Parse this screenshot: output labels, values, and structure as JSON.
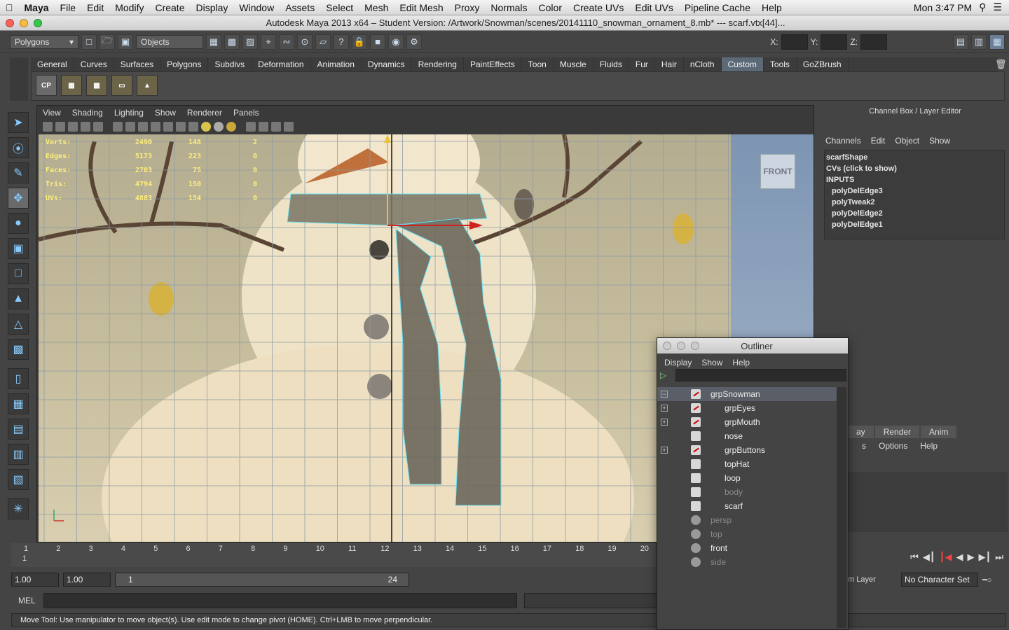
{
  "menubar": {
    "app": "Maya",
    "items": [
      "File",
      "Edit",
      "Modify",
      "Create",
      "Display",
      "Window",
      "Assets",
      "Select",
      "Mesh",
      "Edit Mesh",
      "Proxy",
      "Normals",
      "Color",
      "Create UVs",
      "Edit UVs",
      "Pipeline Cache",
      "Help"
    ],
    "clock": "Mon 3:47 PM"
  },
  "window": {
    "title": "Autodesk Maya 2013 x64 – Student Version: /Artwork/Snowman/scenes/20141110_snowman_ornament_8.mb*   ---   scarf.vtx[44]..."
  },
  "statusline": {
    "mode": "Polygons",
    "select_mode": "Objects",
    "x_label": "X:",
    "y_label": "Y:",
    "z_label": "Z:"
  },
  "shelf": {
    "tabs": [
      "General",
      "Curves",
      "Surfaces",
      "Polygons",
      "Subdivs",
      "Deformation",
      "Animation",
      "Dynamics",
      "Rendering",
      "PaintEffects",
      "Toon",
      "Muscle",
      "Fluids",
      "Fur",
      "Hair",
      "nCloth",
      "Custom",
      "Tools",
      "GoZBrush"
    ],
    "active_tab": "Custom",
    "cp_label": "CP"
  },
  "viewport": {
    "menu": [
      "View",
      "Shading",
      "Lighting",
      "Show",
      "Renderer",
      "Panels"
    ],
    "view_cube": "FRONT",
    "hud": [
      [
        "Verts:",
        "2490",
        "148",
        "2"
      ],
      [
        "Edges:",
        "5173",
        "223",
        "0"
      ],
      [
        "Faces:",
        "2703",
        "75",
        "0"
      ],
      [
        "Tris:",
        "4794",
        "150",
        "0"
      ],
      [
        "UVs:",
        "4883",
        "154",
        "0"
      ]
    ]
  },
  "timeline": {
    "ticks": [
      "1",
      "2",
      "3",
      "4",
      "5",
      "6",
      "7",
      "8",
      "9",
      "10",
      "11",
      "12",
      "13",
      "14",
      "15",
      "16",
      "17",
      "18",
      "19",
      "20"
    ],
    "current": "1"
  },
  "range": {
    "start": "1.00",
    "anim_start": "1.00",
    "min": "1",
    "max": "24"
  },
  "mel": {
    "label": "MEL"
  },
  "helpline": "Move Tool: Use manipulator to move object(s). Use edit mode to change pivot (HOME).  Ctrl+LMB to move perpendicular.",
  "channelbox": {
    "title": "Channel Box / Layer Editor",
    "menu": [
      "Channels",
      "Edit",
      "Object",
      "Show"
    ],
    "items": [
      "scarfShape",
      "CVs (click to show)",
      "INPUTS",
      "polyDelEdge3",
      "polyTweak2",
      "polyDelEdge2",
      "polyDelEdge1"
    ]
  },
  "layers": {
    "tabs": [
      "ay",
      "Render",
      "Anim"
    ],
    "menu": [
      "s",
      "Options",
      "Help"
    ]
  },
  "charset": {
    "layer": "m Layer",
    "character": "No Character Set"
  },
  "outliner": {
    "title": "Outliner",
    "menu": [
      "Display",
      "Show",
      "Help"
    ],
    "rows": [
      {
        "label": "grpSnowman",
        "type": "grp",
        "expand": "−",
        "level": 0,
        "selected": true,
        "dim": false
      },
      {
        "label": "grpEyes",
        "type": "grp",
        "expand": "+",
        "level": 1,
        "selected": false,
        "dim": false
      },
      {
        "label": "grpMouth",
        "type": "grp",
        "expand": "+",
        "level": 1,
        "selected": false,
        "dim": false
      },
      {
        "label": "nose",
        "type": "mesh",
        "expand": "",
        "level": 1,
        "selected": false,
        "dim": false
      },
      {
        "label": "grpButtons",
        "type": "grp",
        "expand": "+",
        "level": 1,
        "selected": false,
        "dim": false
      },
      {
        "label": "topHat",
        "type": "mesh",
        "expand": "",
        "level": 1,
        "selected": false,
        "dim": false
      },
      {
        "label": "loop",
        "type": "mesh",
        "expand": "",
        "level": 1,
        "selected": false,
        "dim": false
      },
      {
        "label": "body",
        "type": "mesh",
        "expand": "",
        "level": 1,
        "selected": false,
        "dim": true
      },
      {
        "label": "scarf",
        "type": "mesh",
        "expand": "",
        "level": 1,
        "selected": false,
        "dim": false
      },
      {
        "label": "persp",
        "type": "cam",
        "expand": "",
        "level": 0,
        "selected": false,
        "dim": true
      },
      {
        "label": "top",
        "type": "cam",
        "expand": "",
        "level": 0,
        "selected": false,
        "dim": true
      },
      {
        "label": "front",
        "type": "cam",
        "expand": "",
        "level": 0,
        "selected": false,
        "dim": false
      },
      {
        "label": "side",
        "type": "cam",
        "expand": "",
        "level": 0,
        "selected": false,
        "dim": true
      }
    ]
  }
}
